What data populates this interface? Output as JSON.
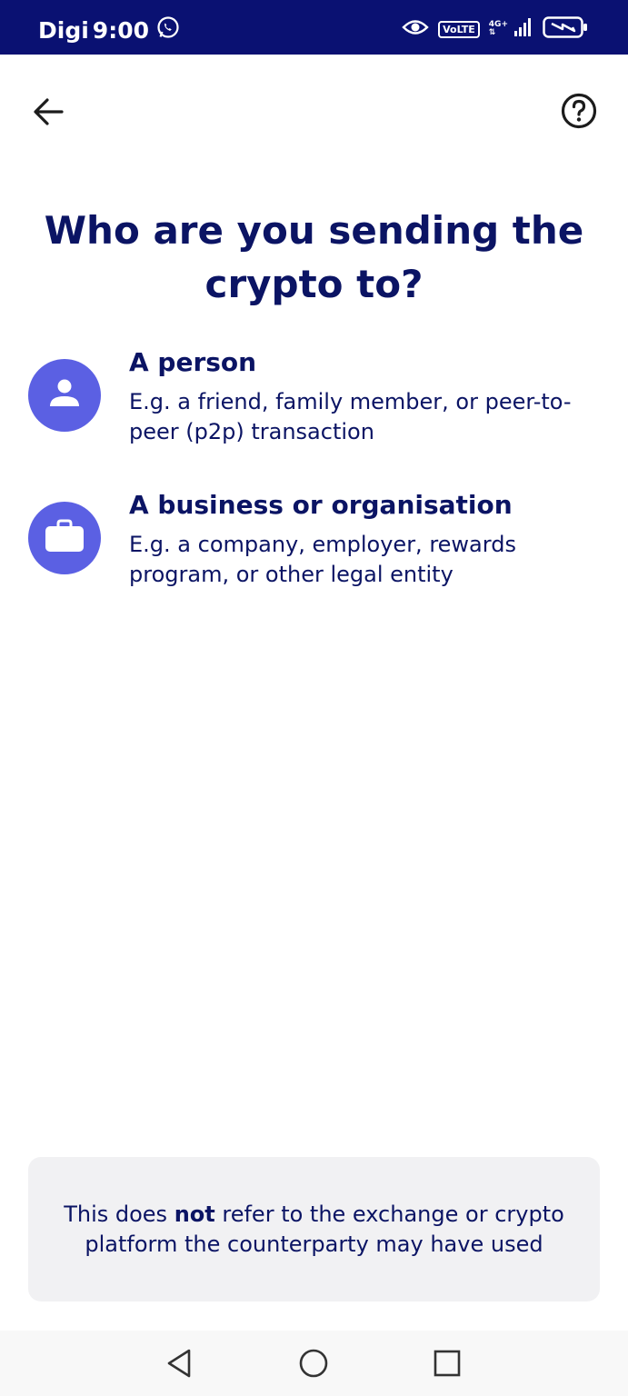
{
  "status_bar": {
    "carrier": "Digi",
    "time": "9:00",
    "volte": "VoLTE",
    "network": "4G+"
  },
  "header": {
    "back_icon": "arrow-left-icon",
    "help_icon": "help-circle-icon"
  },
  "title": "Who are you sending the crypto to?",
  "options": [
    {
      "icon": "person-icon",
      "title": "A person",
      "description": "E.g. a friend, family member, or peer-to-peer (p2p) transaction"
    },
    {
      "icon": "briefcase-icon",
      "title": "A business or organisation",
      "description": "E.g. a company, employer, rewards program, or other legal entity"
    }
  ],
  "info": {
    "prefix": "This does ",
    "emphasis": "not",
    "suffix": " refer to the exchange or crypto platform the counterparty may have used"
  },
  "colors": {
    "status_bar": "#0a1172",
    "text": "#0b1464",
    "accent": "#5b60e3",
    "info_background": "#f1f1f3"
  }
}
